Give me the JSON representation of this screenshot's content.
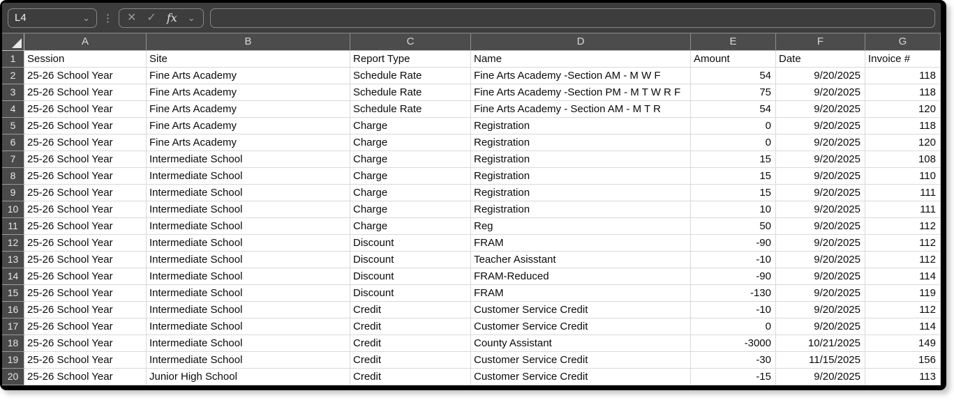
{
  "toolbar": {
    "name_box_value": "L4",
    "formula_value": "",
    "icons": {
      "name_box_dropdown": "⌄",
      "grip_dots": "⋮",
      "cancel": "✕",
      "enter": "✓",
      "insert_function": "fx",
      "fx_dropdown": "⌄"
    }
  },
  "colors": {
    "toolbar_bg": "#3d3d3d",
    "header_bg": "#4c4c4c",
    "frame": "#000000",
    "cell_bg": "#ffffff",
    "gridline": "#d9d9d9"
  },
  "sheet": {
    "column_letters": [
      "A",
      "B",
      "C",
      "D",
      "E",
      "F",
      "G"
    ],
    "rows": [
      {
        "n": 1,
        "cells": [
          "Session",
          "Site",
          "Report Type",
          "Name",
          "Amount",
          "Date",
          "Invoice #"
        ]
      },
      {
        "n": 2,
        "cells": [
          "25-26 School Year",
          "Fine Arts Academy",
          "Schedule Rate",
          "Fine Arts Academy -Section AM - M W F",
          "54",
          "9/20/2025",
          "118"
        ]
      },
      {
        "n": 3,
        "cells": [
          "25-26 School Year",
          "Fine Arts Academy",
          "Schedule Rate",
          "Fine Arts Academy -Section PM - M T W R F",
          "75",
          "9/20/2025",
          "118"
        ]
      },
      {
        "n": 4,
        "cells": [
          "25-26 School Year",
          "Fine Arts Academy",
          "Schedule Rate",
          "Fine Arts Academy - Section AM - M T R",
          "54",
          "9/20/2025",
          "120"
        ]
      },
      {
        "n": 5,
        "cells": [
          "25-26 School Year",
          "Fine Arts Academy",
          "Charge",
          "Registration",
          "0",
          "9/20/2025",
          "118"
        ]
      },
      {
        "n": 6,
        "cells": [
          "25-26 School Year",
          "Fine Arts Academy",
          "Charge",
          "Registration",
          "0",
          "9/20/2025",
          "120"
        ]
      },
      {
        "n": 7,
        "cells": [
          "25-26 School Year",
          "Intermediate School",
          "Charge",
          "Registration",
          "15",
          "9/20/2025",
          "108"
        ]
      },
      {
        "n": 8,
        "cells": [
          "25-26 School Year",
          "Intermediate School",
          "Charge",
          "Registration",
          "15",
          "9/20/2025",
          "110"
        ]
      },
      {
        "n": 9,
        "cells": [
          "25-26 School Year",
          "Intermediate School",
          "Charge",
          "Registration",
          "15",
          "9/20/2025",
          "111"
        ]
      },
      {
        "n": 10,
        "cells": [
          "25-26 School Year",
          "Intermediate School",
          "Charge",
          "Registration",
          "10",
          "9/20/2025",
          "111"
        ]
      },
      {
        "n": 11,
        "cells": [
          "25-26 School Year",
          "Intermediate School",
          "Charge",
          "Reg",
          "50",
          "9/20/2025",
          "112"
        ]
      },
      {
        "n": 12,
        "cells": [
          "25-26 School Year",
          "Intermediate School",
          "Discount",
          "FRAM",
          "-90",
          "9/20/2025",
          "112"
        ]
      },
      {
        "n": 13,
        "cells": [
          "25-26 School Year",
          "Intermediate School",
          "Discount",
          "Teacher Asisstant",
          "-10",
          "9/20/2025",
          "112"
        ]
      },
      {
        "n": 14,
        "cells": [
          "25-26 School Year",
          "Intermediate School",
          "Discount",
          "FRAM-Reduced",
          "-90",
          "9/20/2025",
          "114"
        ]
      },
      {
        "n": 15,
        "cells": [
          "25-26 School Year",
          "Intermediate School",
          "Discount",
          "FRAM",
          "-130",
          "9/20/2025",
          "119"
        ]
      },
      {
        "n": 16,
        "cells": [
          "25-26 School Year",
          "Intermediate School",
          "Credit",
          "Customer Service Credit",
          "-10",
          "9/20/2025",
          "112"
        ]
      },
      {
        "n": 17,
        "cells": [
          "25-26 School Year",
          "Intermediate School",
          "Credit",
          "Customer Service Credit",
          "0",
          "9/20/2025",
          "114"
        ]
      },
      {
        "n": 18,
        "cells": [
          "25-26 School Year",
          "Intermediate School",
          "Credit",
          "County Assistant",
          "-3000",
          "10/21/2025",
          "149"
        ]
      },
      {
        "n": 19,
        "cells": [
          "25-26 School Year",
          "Intermediate School",
          "Credit",
          "Customer Service Credit",
          "-30",
          "11/15/2025",
          "156"
        ]
      },
      {
        "n": 20,
        "cells": [
          "25-26 School Year",
          "Junior High School",
          "Credit",
          "Customer Service Credit",
          "-15",
          "9/20/2025",
          "113"
        ]
      }
    ]
  }
}
